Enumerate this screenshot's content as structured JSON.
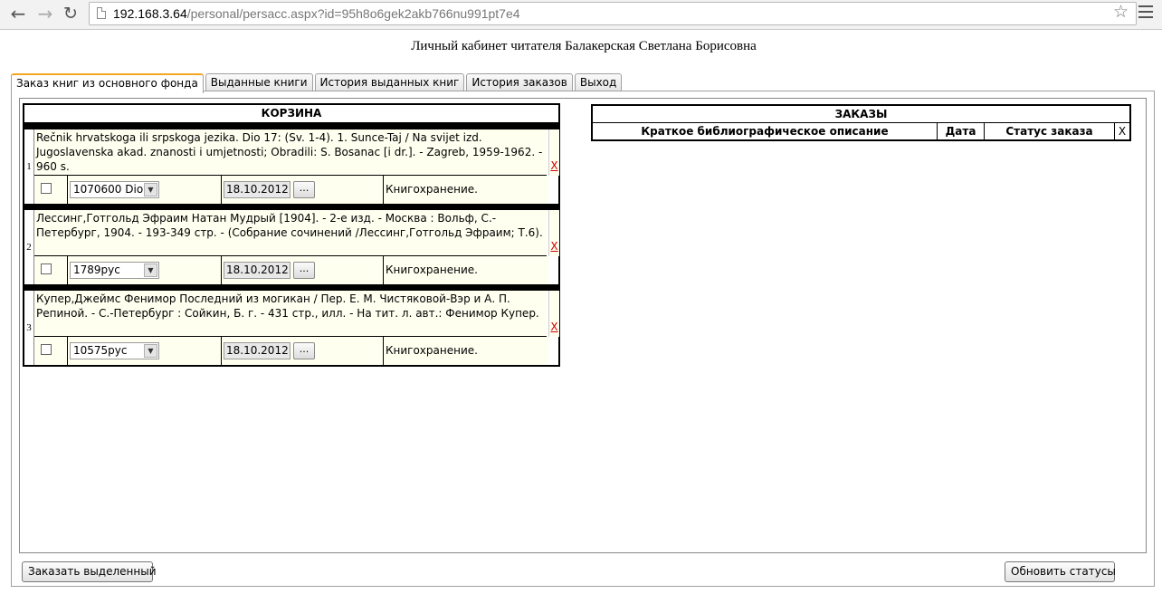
{
  "browser": {
    "url_host": "192.168.3.64",
    "url_path": "/personal/persacc.aspx?id=95h8o6gek2akb766nu991pt7e4"
  },
  "page": {
    "title": "Личный кабинет читателя Балакерская Светлана Борисовна"
  },
  "tabs": [
    {
      "label": "Заказ книг из основного фонда",
      "active": true
    },
    {
      "label": "Выданные книги"
    },
    {
      "label": "История выданных книг"
    },
    {
      "label": "История заказов"
    },
    {
      "label": "Выход"
    }
  ],
  "basket": {
    "title": "КОРЗИНА",
    "items": [
      {
        "number": "1",
        "description": "Rečnik hrvatskoga ili srpskoga jezika. Dio 17: (Sv. 1-4). 1. Sunce-Taj / Na svijet izd. Jugoslavenska akad. znanosti i umjetnosti; Obradili: S. Bosanac [i dr.]. - Zagreb, 1959-1962. - 960 s.",
        "delete": "X",
        "select_value": "1070600 Dio",
        "date": "18.10.2012",
        "date_btn": "...",
        "location": "Книгохранение."
      },
      {
        "number": "2",
        "description": "Лессинг,Готгольд Эфраим Натан Мудрый [1904]. - 2-е изд. - Москва : Вольф, С.-Петербург, 1904. - 193-349 стр. - (Собрание сочинений /Лессинг,Готгольд Эфраим; Т.6).",
        "delete": "X",
        "select_value": "1789рус",
        "date": "18.10.2012",
        "date_btn": "...",
        "location": "Книгохранение."
      },
      {
        "number": "3",
        "description": "Купер,Джеймс Фенимор Последний из могикан / Пер. Е. М. Чистяковой-Вэр и А. П. Репиной. - С.-Петербург : Сойкин, Б. г. - 431 стр., илл. - На тит. л. авт.: Фенимор Купер.",
        "delete": "X",
        "select_value": "10575рус",
        "date": "18.10.2012",
        "date_btn": "...",
        "location": "Книгохранение."
      }
    ]
  },
  "orders": {
    "title": "ЗАКАЗЫ",
    "columns": [
      "Краткое библиографическое описание",
      "Дата",
      "Статус заказа",
      "X"
    ]
  },
  "buttons": {
    "order_selected": "Заказать выделенный",
    "refresh_statuses": "Обновить статусы"
  }
}
